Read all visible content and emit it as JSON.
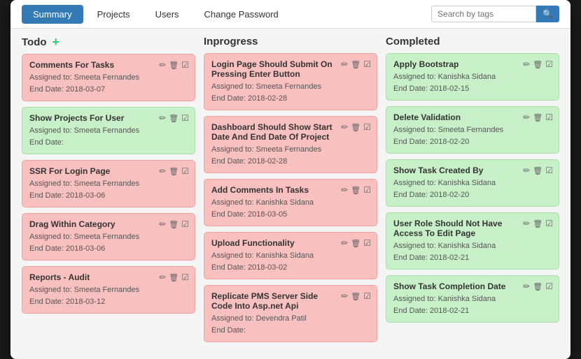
{
  "nav": {
    "tabs": [
      {
        "label": "Summary",
        "active": true
      },
      {
        "label": "Projects",
        "active": false
      },
      {
        "label": "Users",
        "active": false
      },
      {
        "label": "Change Password",
        "active": false
      }
    ],
    "search_placeholder": "Search by tags"
  },
  "columns": [
    {
      "id": "todo",
      "title": "Todo",
      "show_add": true,
      "cards": [
        {
          "title": "Comments For Tasks",
          "assigned": "Smeeta Fernandes",
          "end_date": "2018-03-07",
          "color": "pink"
        },
        {
          "title": "Show Projects For User",
          "assigned": "Smeeta Fernandes",
          "end_date": "",
          "color": "green"
        },
        {
          "title": "SSR For Login Page",
          "assigned": "Smeeta Fernandes",
          "end_date": "2018-03-06",
          "color": "pink"
        },
        {
          "title": "Drag Within Category",
          "assigned": "Smeeta Fernandes",
          "end_date": "2018-03-06",
          "color": "pink"
        },
        {
          "title": "Reports - Audit",
          "assigned": "Smeeta Fernandes",
          "end_date": "2018-03-12",
          "color": "pink"
        }
      ]
    },
    {
      "id": "inprogress",
      "title": "Inprogress",
      "show_add": false,
      "cards": [
        {
          "title": "Login Page Should Submit On Pressing Enter Button",
          "assigned": "Smeeta Fernandes",
          "end_date": "2018-02-28",
          "color": "pink"
        },
        {
          "title": "Dashboard Should Show Start Date And End Date Of Project",
          "assigned": "Smeeta Fernandes",
          "end_date": "2018-02-28",
          "color": "pink"
        },
        {
          "title": "Add Comments In Tasks",
          "assigned": "Kanishka Sidana",
          "end_date": "2018-03-05",
          "color": "pink"
        },
        {
          "title": "Upload Functionality",
          "assigned": "Kanishka Sidana",
          "end_date": "2018-03-02",
          "color": "pink"
        },
        {
          "title": "Replicate PMS Server Side Code Into Asp.net Api",
          "assigned": "Devendra Patil",
          "end_date": "",
          "color": "pink"
        }
      ]
    },
    {
      "id": "completed",
      "title": "Completed",
      "show_add": false,
      "cards": [
        {
          "title": "Apply Bootstrap",
          "assigned": "Kanishka Sidana",
          "end_date": "2018-02-15",
          "color": "green"
        },
        {
          "title": "Delete Validation",
          "assigned": "Smeeta Fernandes",
          "end_date": "2018-02-20",
          "color": "green"
        },
        {
          "title": "Show Task Created By",
          "assigned": "Kanishka Sidana",
          "end_date": "2018-02-20",
          "color": "green"
        },
        {
          "title": "User Role Should Not Have Access To Edit Page",
          "assigned": "Kanishka Sidana",
          "end_date": "2018-02-21",
          "color": "green"
        },
        {
          "title": "Show Task Completion Date",
          "assigned": "Kanishka Sidana",
          "end_date": "2018-02-21",
          "color": "green"
        }
      ]
    }
  ],
  "labels": {
    "assigned_to": "Assigned to:",
    "end_date": "End Date:",
    "search_btn": "🔍"
  }
}
